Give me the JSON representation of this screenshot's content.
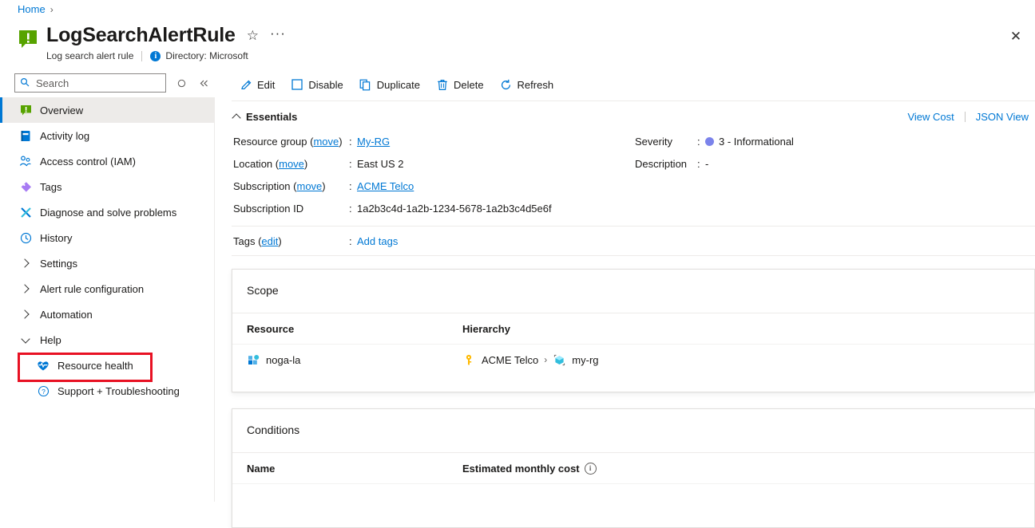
{
  "breadcrumb": {
    "home": "Home",
    "separator": "›"
  },
  "header": {
    "title": "LogSearchAlertRule",
    "subtitle": "Log search alert rule",
    "directory": "Directory: Microsoft",
    "info_badge": "i",
    "star": "☆",
    "ellipsis": "···",
    "close": "✕",
    "icon_name": "log-search-alert-rule-icon"
  },
  "search": {
    "placeholder": "Search",
    "value": ""
  },
  "sidebar": {
    "items": [
      {
        "label": "Overview",
        "icon": "alert-rule-icon",
        "selected": true,
        "type": "item"
      },
      {
        "label": "Activity log",
        "icon": "activity-log-icon",
        "selected": false,
        "type": "item"
      },
      {
        "label": "Access control (IAM)",
        "icon": "people-icon",
        "selected": false,
        "type": "item"
      },
      {
        "label": "Tags",
        "icon": "tag-icon",
        "selected": false,
        "type": "item"
      },
      {
        "label": "Diagnose and solve problems",
        "icon": "wrench-icon",
        "selected": false,
        "type": "item"
      },
      {
        "label": "History",
        "icon": "clock-icon",
        "selected": false,
        "type": "item"
      },
      {
        "label": "Settings",
        "icon": "chevron-right-icon",
        "selected": false,
        "type": "group"
      },
      {
        "label": "Alert rule configuration",
        "icon": "chevron-right-icon",
        "selected": false,
        "type": "group"
      },
      {
        "label": "Automation",
        "icon": "chevron-right-icon",
        "selected": false,
        "type": "group"
      },
      {
        "label": "Help",
        "icon": "chevron-down-icon",
        "selected": false,
        "type": "group"
      },
      {
        "label": "Resource health",
        "icon": "heart-pulse-icon",
        "selected": false,
        "type": "child",
        "highlighted": true
      },
      {
        "label": "Support + Troubleshooting",
        "icon": "question-circle-icon",
        "selected": false,
        "type": "child"
      }
    ]
  },
  "toolbar": {
    "buttons": [
      {
        "label": "Edit",
        "icon": "pencil-icon"
      },
      {
        "label": "Disable",
        "icon": "square-icon"
      },
      {
        "label": "Duplicate",
        "icon": "copy-icon"
      },
      {
        "label": "Delete",
        "icon": "trash-icon"
      },
      {
        "label": "Refresh",
        "icon": "refresh-icon"
      }
    ]
  },
  "essentials": {
    "title": "Essentials",
    "view_cost": "View Cost",
    "json_view": "JSON View",
    "left": [
      {
        "key": "Resource group",
        "key_link": "move",
        "colon": ":",
        "value": "My-RG",
        "value_is_link": true
      },
      {
        "key": "Location",
        "key_link": "move",
        "colon": ":",
        "value": "East US 2",
        "value_is_link": false
      },
      {
        "key": "Subscription",
        "key_link": "move",
        "colon": ":",
        "value": "ACME Telco",
        "value_is_link": true
      },
      {
        "key": "Subscription ID",
        "key_link": "",
        "colon": ":",
        "value": "1a2b3c4d-1a2b-1234-5678-1a2b3c4d5e6f",
        "value_is_link": false
      }
    ],
    "right": [
      {
        "key": "Severity",
        "colon": ":",
        "value": "3 - Informational",
        "has_dot": true,
        "dot_color": "#7b83eb"
      },
      {
        "key": "Description",
        "colon": ":",
        "value": "-",
        "has_dot": false
      }
    ],
    "tags": {
      "key": "Tags",
      "key_link": "edit",
      "colon": ":",
      "value": "Add tags"
    }
  },
  "scope": {
    "title": "Scope",
    "columns": {
      "resource": "Resource",
      "hierarchy": "Hierarchy"
    },
    "rows": [
      {
        "resource": "noga-la",
        "resource_icon": "log-analytics-workspace-icon",
        "hierarchy": [
          {
            "label": "ACME Telco",
            "icon": "subscription-key-icon"
          },
          {
            "label": "my-rg",
            "icon": "resource-group-icon"
          }
        ],
        "separator": "›"
      }
    ]
  },
  "conditions": {
    "title": "Conditions",
    "columns": {
      "name": "Name",
      "cost": "Estimated monthly cost"
    },
    "info": "i"
  }
}
